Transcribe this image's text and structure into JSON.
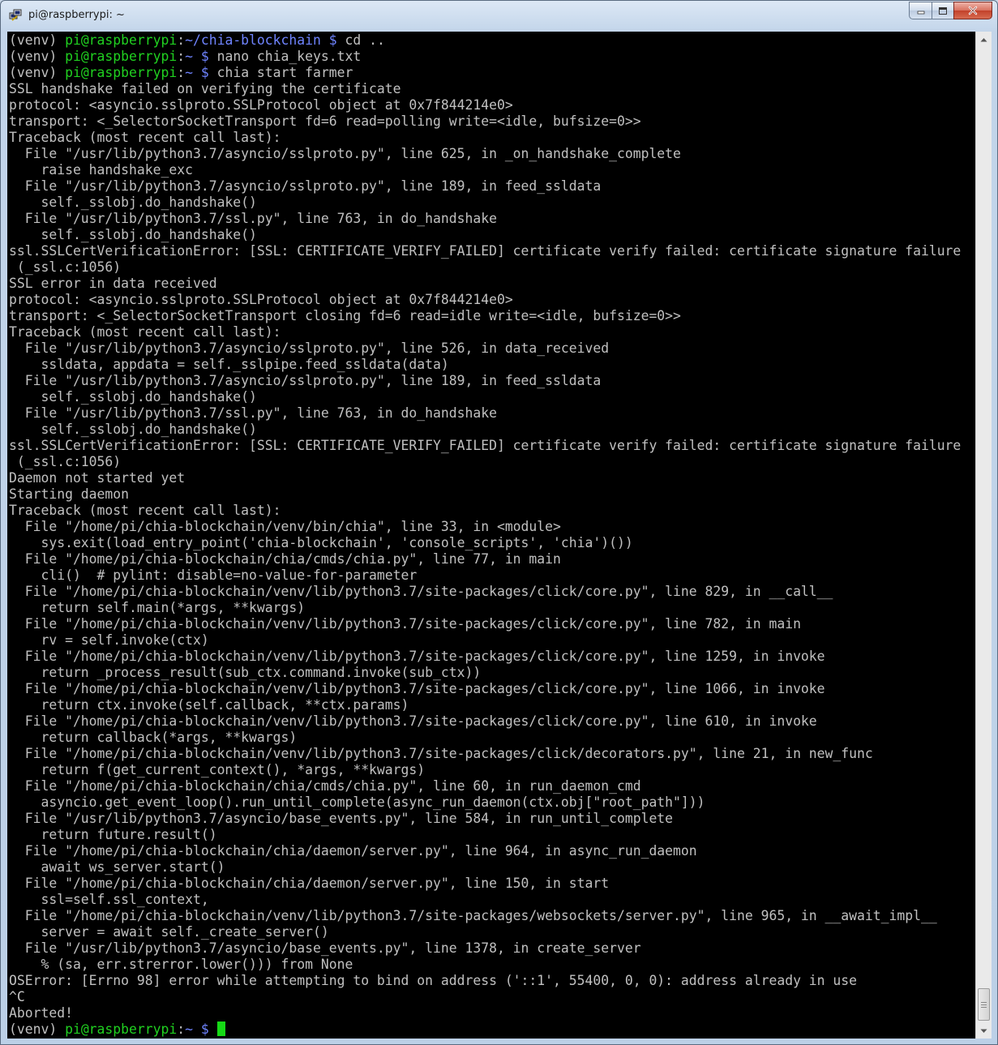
{
  "window": {
    "title": "pi@raspberrypi: ~"
  },
  "colors": {
    "terminal_bg": "#000000",
    "text": "#c0c0c0",
    "host": "#20d020",
    "path": "#6f84ff",
    "cursor": "#16d916"
  },
  "terminal": {
    "lines": [
      {
        "segments": [
          {
            "t": "(venv) ",
            "c": "venv"
          },
          {
            "t": "pi@raspberrypi",
            "c": "host"
          },
          {
            "t": ":",
            "c": "plain"
          },
          {
            "t": "~/chia-blockchain $",
            "c": "path"
          },
          {
            "t": " cd ..",
            "c": "plain"
          }
        ]
      },
      {
        "segments": [
          {
            "t": "(venv) ",
            "c": "venv"
          },
          {
            "t": "pi@raspberrypi",
            "c": "host"
          },
          {
            "t": ":",
            "c": "plain"
          },
          {
            "t": "~ $",
            "c": "path"
          },
          {
            "t": " nano chia_keys.txt",
            "c": "plain"
          }
        ]
      },
      {
        "segments": [
          {
            "t": "(venv) ",
            "c": "venv"
          },
          {
            "t": "pi@raspberrypi",
            "c": "host"
          },
          {
            "t": ":",
            "c": "plain"
          },
          {
            "t": "~ $",
            "c": "path"
          },
          {
            "t": " chia start farmer",
            "c": "plain"
          }
        ]
      },
      {
        "segments": [
          {
            "t": "SSL handshake failed on verifying the certificate",
            "c": "plain"
          }
        ]
      },
      {
        "segments": [
          {
            "t": "protocol: <asyncio.sslproto.SSLProtocol object at 0x7f844214e0>",
            "c": "plain"
          }
        ]
      },
      {
        "segments": [
          {
            "t": "transport: <_SelectorSocketTransport fd=6 read=polling write=<idle, bufsize=0>>",
            "c": "plain"
          }
        ]
      },
      {
        "segments": [
          {
            "t": "Traceback (most recent call last):",
            "c": "plain"
          }
        ]
      },
      {
        "segments": [
          {
            "t": "  File \"/usr/lib/python3.7/asyncio/sslproto.py\", line 625, in _on_handshake_complete",
            "c": "plain"
          }
        ]
      },
      {
        "segments": [
          {
            "t": "    raise handshake_exc",
            "c": "plain"
          }
        ]
      },
      {
        "segments": [
          {
            "t": "  File \"/usr/lib/python3.7/asyncio/sslproto.py\", line 189, in feed_ssldata",
            "c": "plain"
          }
        ]
      },
      {
        "segments": [
          {
            "t": "    self._sslobj.do_handshake()",
            "c": "plain"
          }
        ]
      },
      {
        "segments": [
          {
            "t": "  File \"/usr/lib/python3.7/ssl.py\", line 763, in do_handshake",
            "c": "plain"
          }
        ]
      },
      {
        "segments": [
          {
            "t": "    self._sslobj.do_handshake()",
            "c": "plain"
          }
        ]
      },
      {
        "segments": [
          {
            "t": "ssl.SSLCertVerificationError: [SSL: CERTIFICATE_VERIFY_FAILED] certificate verify failed: certificate signature failure",
            "c": "plain"
          }
        ]
      },
      {
        "segments": [
          {
            "t": " (_ssl.c:1056)",
            "c": "plain"
          }
        ]
      },
      {
        "segments": [
          {
            "t": "SSL error in data received",
            "c": "plain"
          }
        ]
      },
      {
        "segments": [
          {
            "t": "protocol: <asyncio.sslproto.SSLProtocol object at 0x7f844214e0>",
            "c": "plain"
          }
        ]
      },
      {
        "segments": [
          {
            "t": "transport: <_SelectorSocketTransport closing fd=6 read=idle write=<idle, bufsize=0>>",
            "c": "plain"
          }
        ]
      },
      {
        "segments": [
          {
            "t": "Traceback (most recent call last):",
            "c": "plain"
          }
        ]
      },
      {
        "segments": [
          {
            "t": "  File \"/usr/lib/python3.7/asyncio/sslproto.py\", line 526, in data_received",
            "c": "plain"
          }
        ]
      },
      {
        "segments": [
          {
            "t": "    ssldata, appdata = self._sslpipe.feed_ssldata(data)",
            "c": "plain"
          }
        ]
      },
      {
        "segments": [
          {
            "t": "  File \"/usr/lib/python3.7/asyncio/sslproto.py\", line 189, in feed_ssldata",
            "c": "plain"
          }
        ]
      },
      {
        "segments": [
          {
            "t": "    self._sslobj.do_handshake()",
            "c": "plain"
          }
        ]
      },
      {
        "segments": [
          {
            "t": "  File \"/usr/lib/python3.7/ssl.py\", line 763, in do_handshake",
            "c": "plain"
          }
        ]
      },
      {
        "segments": [
          {
            "t": "    self._sslobj.do_handshake()",
            "c": "plain"
          }
        ]
      },
      {
        "segments": [
          {
            "t": "ssl.SSLCertVerificationError: [SSL: CERTIFICATE_VERIFY_FAILED] certificate verify failed: certificate signature failure",
            "c": "plain"
          }
        ]
      },
      {
        "segments": [
          {
            "t": " (_ssl.c:1056)",
            "c": "plain"
          }
        ]
      },
      {
        "segments": [
          {
            "t": "Daemon not started yet",
            "c": "plain"
          }
        ]
      },
      {
        "segments": [
          {
            "t": "Starting daemon",
            "c": "plain"
          }
        ]
      },
      {
        "segments": [
          {
            "t": "Traceback (most recent call last):",
            "c": "plain"
          }
        ]
      },
      {
        "segments": [
          {
            "t": "  File \"/home/pi/chia-blockchain/venv/bin/chia\", line 33, in <module>",
            "c": "plain"
          }
        ]
      },
      {
        "segments": [
          {
            "t": "    sys.exit(load_entry_point('chia-blockchain', 'console_scripts', 'chia')())",
            "c": "plain"
          }
        ]
      },
      {
        "segments": [
          {
            "t": "  File \"/home/pi/chia-blockchain/chia/cmds/chia.py\", line 77, in main",
            "c": "plain"
          }
        ]
      },
      {
        "segments": [
          {
            "t": "    cli()  # pylint: disable=no-value-for-parameter",
            "c": "plain"
          }
        ]
      },
      {
        "segments": [
          {
            "t": "  File \"/home/pi/chia-blockchain/venv/lib/python3.7/site-packages/click/core.py\", line 829, in __call__",
            "c": "plain"
          }
        ]
      },
      {
        "segments": [
          {
            "t": "    return self.main(*args, **kwargs)",
            "c": "plain"
          }
        ]
      },
      {
        "segments": [
          {
            "t": "  File \"/home/pi/chia-blockchain/venv/lib/python3.7/site-packages/click/core.py\", line 782, in main",
            "c": "plain"
          }
        ]
      },
      {
        "segments": [
          {
            "t": "    rv = self.invoke(ctx)",
            "c": "plain"
          }
        ]
      },
      {
        "segments": [
          {
            "t": "  File \"/home/pi/chia-blockchain/venv/lib/python3.7/site-packages/click/core.py\", line 1259, in invoke",
            "c": "plain"
          }
        ]
      },
      {
        "segments": [
          {
            "t": "    return _process_result(sub_ctx.command.invoke(sub_ctx))",
            "c": "plain"
          }
        ]
      },
      {
        "segments": [
          {
            "t": "  File \"/home/pi/chia-blockchain/venv/lib/python3.7/site-packages/click/core.py\", line 1066, in invoke",
            "c": "plain"
          }
        ]
      },
      {
        "segments": [
          {
            "t": "    return ctx.invoke(self.callback, **ctx.params)",
            "c": "plain"
          }
        ]
      },
      {
        "segments": [
          {
            "t": "  File \"/home/pi/chia-blockchain/venv/lib/python3.7/site-packages/click/core.py\", line 610, in invoke",
            "c": "plain"
          }
        ]
      },
      {
        "segments": [
          {
            "t": "    return callback(*args, **kwargs)",
            "c": "plain"
          }
        ]
      },
      {
        "segments": [
          {
            "t": "  File \"/home/pi/chia-blockchain/venv/lib/python3.7/site-packages/click/decorators.py\", line 21, in new_func",
            "c": "plain"
          }
        ]
      },
      {
        "segments": [
          {
            "t": "    return f(get_current_context(), *args, **kwargs)",
            "c": "plain"
          }
        ]
      },
      {
        "segments": [
          {
            "t": "  File \"/home/pi/chia-blockchain/chia/cmds/chia.py\", line 60, in run_daemon_cmd",
            "c": "plain"
          }
        ]
      },
      {
        "segments": [
          {
            "t": "    asyncio.get_event_loop().run_until_complete(async_run_daemon(ctx.obj[\"root_path\"]))",
            "c": "plain"
          }
        ]
      },
      {
        "segments": [
          {
            "t": "  File \"/usr/lib/python3.7/asyncio/base_events.py\", line 584, in run_until_complete",
            "c": "plain"
          }
        ]
      },
      {
        "segments": [
          {
            "t": "    return future.result()",
            "c": "plain"
          }
        ]
      },
      {
        "segments": [
          {
            "t": "  File \"/home/pi/chia-blockchain/chia/daemon/server.py\", line 964, in async_run_daemon",
            "c": "plain"
          }
        ]
      },
      {
        "segments": [
          {
            "t": "    await ws_server.start()",
            "c": "plain"
          }
        ]
      },
      {
        "segments": [
          {
            "t": "  File \"/home/pi/chia-blockchain/chia/daemon/server.py\", line 150, in start",
            "c": "plain"
          }
        ]
      },
      {
        "segments": [
          {
            "t": "    ssl=self.ssl_context,",
            "c": "plain"
          }
        ]
      },
      {
        "segments": [
          {
            "t": "  File \"/home/pi/chia-blockchain/venv/lib/python3.7/site-packages/websockets/server.py\", line 965, in __await_impl__",
            "c": "plain"
          }
        ]
      },
      {
        "segments": [
          {
            "t": "    server = await self._create_server()",
            "c": "plain"
          }
        ]
      },
      {
        "segments": [
          {
            "t": "  File \"/usr/lib/python3.7/asyncio/base_events.py\", line 1378, in create_server",
            "c": "plain"
          }
        ]
      },
      {
        "segments": [
          {
            "t": "    % (sa, err.strerror.lower())) from None",
            "c": "plain"
          }
        ]
      },
      {
        "segments": [
          {
            "t": "OSError: [Errno 98] error while attempting to bind on address ('::1', 55400, 0, 0): address already in use",
            "c": "plain"
          }
        ]
      },
      {
        "segments": [
          {
            "t": "^C",
            "c": "plain"
          }
        ]
      },
      {
        "segments": [
          {
            "t": "Aborted!",
            "c": "plain"
          }
        ]
      },
      {
        "segments": [
          {
            "t": "(venv) ",
            "c": "venv"
          },
          {
            "t": "pi@raspberrypi",
            "c": "host"
          },
          {
            "t": ":",
            "c": "plain"
          },
          {
            "t": "~ $",
            "c": "path"
          },
          {
            "t": " ",
            "c": "plain"
          }
        ],
        "cursor": true
      }
    ]
  }
}
